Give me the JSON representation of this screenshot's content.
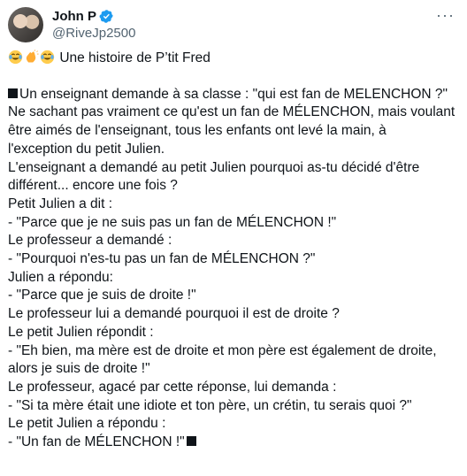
{
  "author": {
    "name": "John P",
    "handle": "@RiveJp2500",
    "verified": true
  },
  "icons": {
    "verified": "verified-badge-icon",
    "more": "more-options-icon",
    "emoji_laugh": "face-with-tears-of-joy",
    "emoji_clap": "clapping-hands"
  },
  "colors": {
    "verified": "#1d9bf0",
    "handle": "#536471",
    "text": "#0f1419"
  },
  "post": {
    "intro": "Une histoire de P’tit Fred",
    "lines": [
      "Un enseignant demande à sa classe : \"qui est fan de MELENCHON ?\"",
      "Ne sachant pas vraiment ce qu'est un fan de MÉLENCHON, mais voulant",
      "être aimés de l'enseignant, tous les enfants ont levé la main, à",
      "l'exception du petit Julien.",
      "L'enseignant a demandé au petit Julien pourquoi as-tu décidé d'être",
      "différent... encore une fois ?",
      "Petit Julien a dit :",
      "- \"Parce que je ne suis pas un fan de MÉLENCHON !\"",
      "Le professeur a demandé :",
      "- \"Pourquoi n'es-tu pas un fan de MÉLENCHON ?\"",
      "Julien a répondu:",
      "- \"Parce que je suis de droite !\"",
      "Le professeur lui a demandé pourquoi il est de droite ?",
      "Le petit Julien répondit :",
      "- \"Eh bien, ma mère est de droite et mon père est également de droite,",
      "alors je suis de droite !\"",
      "Le professeur, agacé par cette réponse, lui demanda :",
      "- \"Si ta mère était une idiote et ton père, un crétin, tu serais quoi ?\"",
      "Le petit Julien a répondu :",
      "- \"Un fan de MÉLENCHON !\""
    ]
  }
}
